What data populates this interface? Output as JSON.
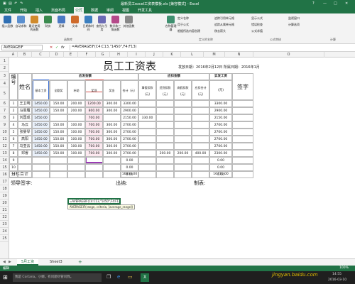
{
  "window": {
    "title": "最新员工excel工资表模板.xls [兼容模式] - Excel",
    "minimize": "—",
    "maximize": "□",
    "close": "✕",
    "help": "?"
  },
  "tabs": [
    "文件",
    "开始",
    "插入",
    "页面布局",
    "公式",
    "数据",
    "审阅",
    "视图",
    "开发工具"
  ],
  "active_tab": 4,
  "ribbon": {
    "buttons": [
      {
        "label": "插入函数",
        "color": "#2f6fb3"
      },
      {
        "label": "自动求和",
        "color": "#5a8fcf"
      },
      {
        "label": "最近使用的函数",
        "color": "#d08a2b"
      },
      {
        "label": "财务",
        "color": "#3a8a4e"
      },
      {
        "label": "逻辑",
        "color": "#4a79c3"
      },
      {
        "label": "文本",
        "color": "#cf6a2b"
      },
      {
        "label": "日期和时间",
        "color": "#3b7fbf"
      },
      {
        "label": "查找与引用",
        "color": "#6b6bb5"
      },
      {
        "label": "数学和三角函数",
        "color": "#b54a8a"
      },
      {
        "label": "其他函数",
        "color": "#888888"
      },
      {
        "label": "名称管理器",
        "color": "#3f8f6f"
      }
    ],
    "side_items": [
      "定义名称",
      "用于公式",
      "根据所选内容创建",
      "追踪引用单元格",
      "追踪从属单元格",
      "移去箭头",
      "显示公式",
      "错误检查",
      "公式求值",
      "监视窗口",
      "计算选项"
    ],
    "groups": [
      "函数库",
      "定义的名称",
      "公式审核",
      "计算"
    ]
  },
  "formula_bar": {
    "name_box": "AVERAGEIF",
    "cancel": "✕",
    "enter": "✓",
    "fx": "fx",
    "formula": "=AVERAGEIF(C4:C13,\"1450\",F4:F13)"
  },
  "columns": [
    "A",
    "B",
    "C",
    "D",
    "E",
    "F",
    "G",
    "H",
    "I",
    "J",
    "K",
    "L",
    "M",
    "N",
    "O"
  ],
  "rows": [
    "1",
    "2",
    "3",
    "4",
    "5",
    "6",
    "7",
    "8",
    "9",
    "10",
    "11",
    "12",
    "13",
    "14",
    "15",
    "16",
    "17",
    "18",
    "19",
    "20",
    "21",
    "22",
    "23",
    "24",
    "25"
  ],
  "sheet": {
    "title": "员工工资表",
    "issue_date": "发放日期：2016年2月12日  所属日期：2016年1月",
    "header_no": "编号",
    "header_name": "姓名",
    "header_due": "应发金额",
    "header_deduct": "应扣金额",
    "header_actual": "实发工资",
    "header_sign": "签字",
    "sub_due": [
      "基本工资",
      "全勤奖",
      "补助",
      "奖项",
      "奖金",
      "合计（元）"
    ],
    "sub_deduct": [
      "事假扣款(元)",
      "迟到扣款(元)",
      "病假扣款(元)",
      "应扣合计(元)"
    ],
    "sub_actual": "(元)",
    "employees": [
      {
        "no": "1",
        "name": "王卫明",
        "base": "1450.00",
        "attend": "150.00",
        "subsidy": "200.00",
        "award": "1200.00",
        "bonus": "300.00",
        "total": "3300.00",
        "leave": "",
        "late": "",
        "sick": "",
        "deduct": "",
        "net": "3300.00"
      },
      {
        "no": "2",
        "name": "马雯雁",
        "base": "1450.00",
        "attend": "150.00",
        "subsidy": "200.00",
        "award": "800.00",
        "bonus": "300.00",
        "total": "2900.00",
        "leave": "",
        "late": "",
        "sick": "",
        "deduct": "",
        "net": "2900.00"
      },
      {
        "no": "3",
        "name": "刘国成",
        "base": "1450.00",
        "attend": "",
        "subsidy": "",
        "award": "700.00",
        "bonus": "",
        "total": "2150.00",
        "leave": "330.00",
        "late": "",
        "sick": "",
        "deduct": "",
        "net": "2150.00"
      },
      {
        "no": "4",
        "name": "马云",
        "base": "1450.00",
        "attend": "150.00",
        "subsidy": "100.00",
        "award": "700.00",
        "bonus": "300.00",
        "total": "2700.00",
        "leave": "",
        "late": "",
        "sick": "",
        "deduct": "",
        "net": "2700.00"
      },
      {
        "no": "5",
        "name": "张婴琴",
        "base": "1450.00",
        "attend": "150.00",
        "subsidy": "100.00",
        "award": "700.00",
        "bonus": "300.00",
        "total": "2700.00",
        "leave": "",
        "late": "",
        "sick": "",
        "deduct": "",
        "net": "2700.00"
      },
      {
        "no": "6",
        "name": "高阳",
        "base": "1450.00",
        "attend": "150.00",
        "subsidy": "100.00",
        "award": "700.00",
        "bonus": "300.00",
        "total": "2700.00",
        "leave": "",
        "late": "",
        "sick": "",
        "deduct": "",
        "net": "2700.00"
      },
      {
        "no": "7",
        "name": "马亚云",
        "base": "1450.00",
        "attend": "150.00",
        "subsidy": "100.00",
        "award": "700.00",
        "bonus": "300.00",
        "total": "2700.00",
        "leave": "",
        "late": "",
        "sick": "",
        "deduct": "",
        "net": "2700.00"
      },
      {
        "no": "8",
        "name": "邓睿",
        "base": "1450.00",
        "attend": "150.00",
        "subsidy": "100.00",
        "award": "700.00",
        "bonus": "300.00",
        "total": "2700.00",
        "leave": "",
        "late": "200.00",
        "sick": "200.00",
        "deduct": "400.00",
        "net": "2300.00"
      },
      {
        "no": "9",
        "name": "",
        "base": "",
        "attend": "",
        "subsidy": "",
        "award": "",
        "bonus": "",
        "total": "0.00",
        "leave": "",
        "late": "",
        "sick": "",
        "deduct": "",
        "net": "0.00"
      },
      {
        "no": "10",
        "name": "",
        "base": "",
        "attend": "",
        "subsidy": "",
        "award": "",
        "bonus": "",
        "total": "0.00",
        "leave": "",
        "late": "",
        "sick": "",
        "deduct": "",
        "net": "0.00"
      },
      {
        "no": "11",
        "name": "",
        "base": "",
        "attend": "",
        "subsidy": "",
        "award": "",
        "bonus": "",
        "total": "0.00",
        "leave": "",
        "late": "",
        "sick": "",
        "deduct": "",
        "net": "0.00"
      }
    ],
    "subtotal_label": "分栏合计",
    "subtotal_total": "16800.00",
    "subtotal_net": "16770.00",
    "sign_leader": "领导签字:",
    "sign_cashier": "出纳:",
    "sign_maker": "制表:",
    "edit_cell": "=AVERAGEIF(C4:C13,\"1450\",F4:F13)",
    "tooltip": "AVERAGEIF(range, criteria, [average_range])"
  },
  "sheet_tabs": [
    "5月工资",
    "Sheet3"
  ],
  "add_sheet": "+",
  "status": {
    "mode": "编辑",
    "zoom": "100%"
  },
  "taskbar": {
    "search": "我是 Cortana，小娜。有问题尽管问我。",
    "time": "14:55",
    "date": "2016-03-10",
    "watermark": "jingyan.baidu.com"
  }
}
